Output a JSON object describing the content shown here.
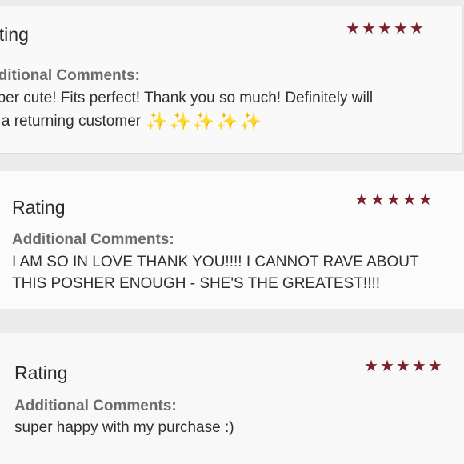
{
  "colors": {
    "star": "#7d1f2c",
    "sparkle": "#f1cf3a",
    "title_text": "#2b2b2b",
    "label_text": "#6b6b6b",
    "body_text": "#2f2f2f",
    "page_background": "#ececec"
  },
  "icons": {
    "star": "star-icon",
    "sparkle": "sparkle-icon"
  },
  "reviews": [
    {
      "rating_title": "ating",
      "stars": 5,
      "comments_label": "dditional Comments:",
      "comment_lines": [
        "uper cute! Fits perfect! Thank you so much! Definitely will",
        "e a returning customer"
      ],
      "sparkle_count": 5
    },
    {
      "rating_title": "Rating",
      "stars": 5,
      "comments_label": "Additional Comments:",
      "comment_lines": [
        "I AM SO IN LOVE THANK YOU!!!! I CANNOT RAVE ABOUT",
        "THIS POSHER ENOUGH - SHE'S THE GREATEST!!!!"
      ],
      "sparkle_count": 0
    },
    {
      "rating_title": "Rating",
      "stars": 5,
      "comments_label": "Additional Comments:",
      "comment_lines": [
        "super happy with my purchase :)"
      ],
      "sparkle_count": 0
    }
  ]
}
